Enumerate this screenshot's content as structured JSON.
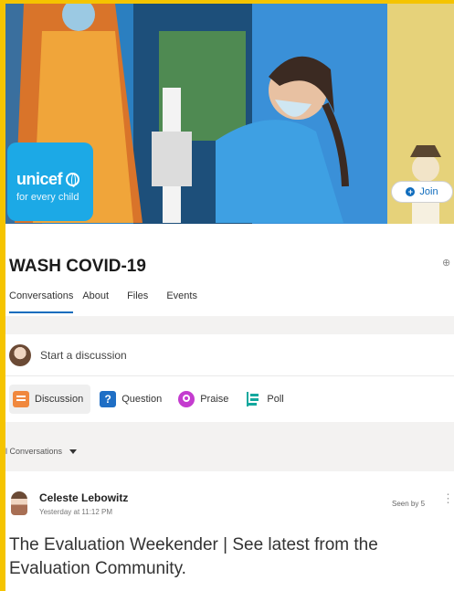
{
  "cover": {
    "brand": "unicef",
    "tagline": "for every child",
    "join_label": "Join"
  },
  "group": {
    "title": "WASH COVID-19",
    "header_icon": "⊕",
    "tabs": [
      {
        "label": "Conversations",
        "active": true
      },
      {
        "label": "About",
        "active": false
      },
      {
        "label": "Files",
        "active": false
      },
      {
        "label": "Events",
        "active": false
      }
    ]
  },
  "composer": {
    "placeholder": "Start a discussion",
    "actions": [
      {
        "label": "Discussion",
        "icon": "discussion-icon",
        "selected": true
      },
      {
        "label": "Question",
        "icon": "question-icon",
        "selected": false
      },
      {
        "label": "Praise",
        "icon": "praise-icon",
        "selected": false
      },
      {
        "label": "Poll",
        "icon": "poll-icon",
        "selected": false
      }
    ]
  },
  "filter": {
    "label": "l Conversations"
  },
  "post": {
    "author": "Celeste Lebowitz",
    "time": "Yesterday at 11:12 PM",
    "seen": "Seen by 5",
    "more": "⋮",
    "body": "The Evaluation Weekender | See latest from the Evaluation Community."
  },
  "colors": {
    "frame": "#f5c400",
    "accent": "#0f6cbd",
    "unicef_blue": "#1ca9e6"
  }
}
